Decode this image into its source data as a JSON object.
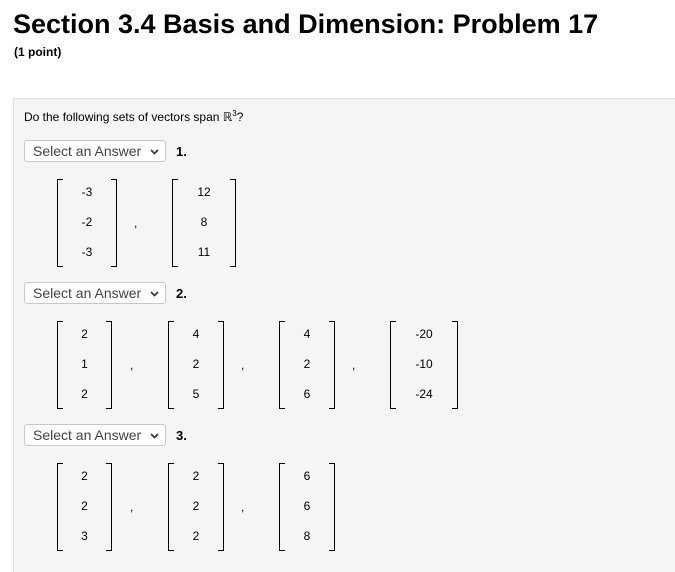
{
  "title": "Section 3.4 Basis and Dimension: Problem 17",
  "points": "(1 point)",
  "question": "Do the following sets of vectors span ℝ",
  "question_sup": "3",
  "question_end": "?",
  "select_placeholder": "Select an Answer",
  "comma": ",",
  "parts": [
    {
      "number": "1.",
      "vectors": [
        {
          "entries": [
            "-3",
            "-2",
            "-3"
          ]
        },
        {
          "entries": [
            "12",
            "8",
            "11"
          ]
        }
      ]
    },
    {
      "number": "2.",
      "vectors": [
        {
          "entries": [
            "2",
            "1",
            "2"
          ]
        },
        {
          "entries": [
            "4",
            "2",
            "5"
          ]
        },
        {
          "entries": [
            "4",
            "2",
            "6"
          ]
        },
        {
          "entries": [
            "-20",
            "-10",
            "-24"
          ]
        }
      ]
    },
    {
      "number": "3.",
      "vectors": [
        {
          "entries": [
            "2",
            "2",
            "3"
          ]
        },
        {
          "entries": [
            "2",
            "2",
            "2"
          ]
        },
        {
          "entries": [
            "6",
            "6",
            "8"
          ]
        }
      ]
    }
  ]
}
